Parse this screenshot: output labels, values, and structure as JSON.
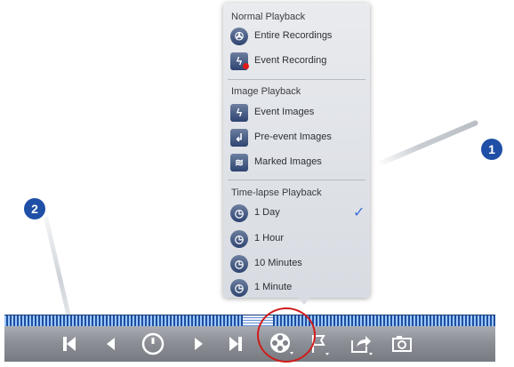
{
  "menu": {
    "sections": [
      {
        "header": "Normal Playback",
        "items": [
          {
            "label": "Entire Recordings",
            "icon": "film-reel-icon"
          },
          {
            "label": "Event Recording",
            "icon": "event-recording-icon"
          }
        ]
      },
      {
        "header": "Image Playback",
        "items": [
          {
            "label": "Event Images",
            "icon": "lightning-icon"
          },
          {
            "label": "Pre-event Images",
            "icon": "pre-event-icon"
          },
          {
            "label": "Marked Images",
            "icon": "marked-images-icon"
          }
        ]
      },
      {
        "header": "Time-lapse Playback",
        "items": [
          {
            "label": "1 Day",
            "icon": "clock-day-icon",
            "selected": true
          },
          {
            "label": "1 Hour",
            "icon": "clock-hour-icon"
          },
          {
            "label": "10 Minutes",
            "icon": "clock-10min-icon"
          },
          {
            "label": "1 Minute",
            "icon": "clock-1min-icon"
          }
        ]
      }
    ]
  },
  "callouts": {
    "one": "1",
    "two": "2"
  },
  "toolbar": {
    "buttons": [
      "skip-to-start-icon",
      "step-back-icon",
      "pause-circle-icon",
      "step-forward-icon",
      "skip-to-end-icon",
      "film-reel-icon",
      "flag-icon",
      "export-icon",
      "snapshot-icon"
    ]
  },
  "colors": {
    "accent": "#1f4fa6",
    "highlight_ring": "#d01b1b",
    "check": "#3d6fd6"
  }
}
